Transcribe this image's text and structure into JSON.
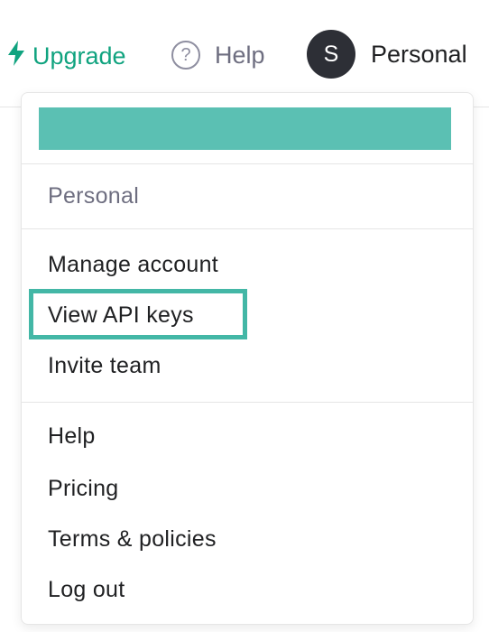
{
  "nav": {
    "upgrade_label": "Upgrade",
    "help_label": "Help",
    "help_icon_glyph": "?",
    "account_initial": "S",
    "account_name": "Personal"
  },
  "menu": {
    "org_label": "Personal",
    "account_items": [
      "Manage account",
      "View API keys",
      "Invite team"
    ],
    "support_items": [
      "Help",
      "Pricing",
      "Terms & policies",
      "Log out"
    ]
  },
  "colors": {
    "accent_green": "#10a37f",
    "header_bar_teal": "#5bc0b3",
    "highlight_teal": "#43b7a6",
    "avatar_bg": "#2d2f36"
  },
  "icons": {
    "upgrade": "lightning-bolt-icon",
    "help": "question-circle-icon"
  }
}
